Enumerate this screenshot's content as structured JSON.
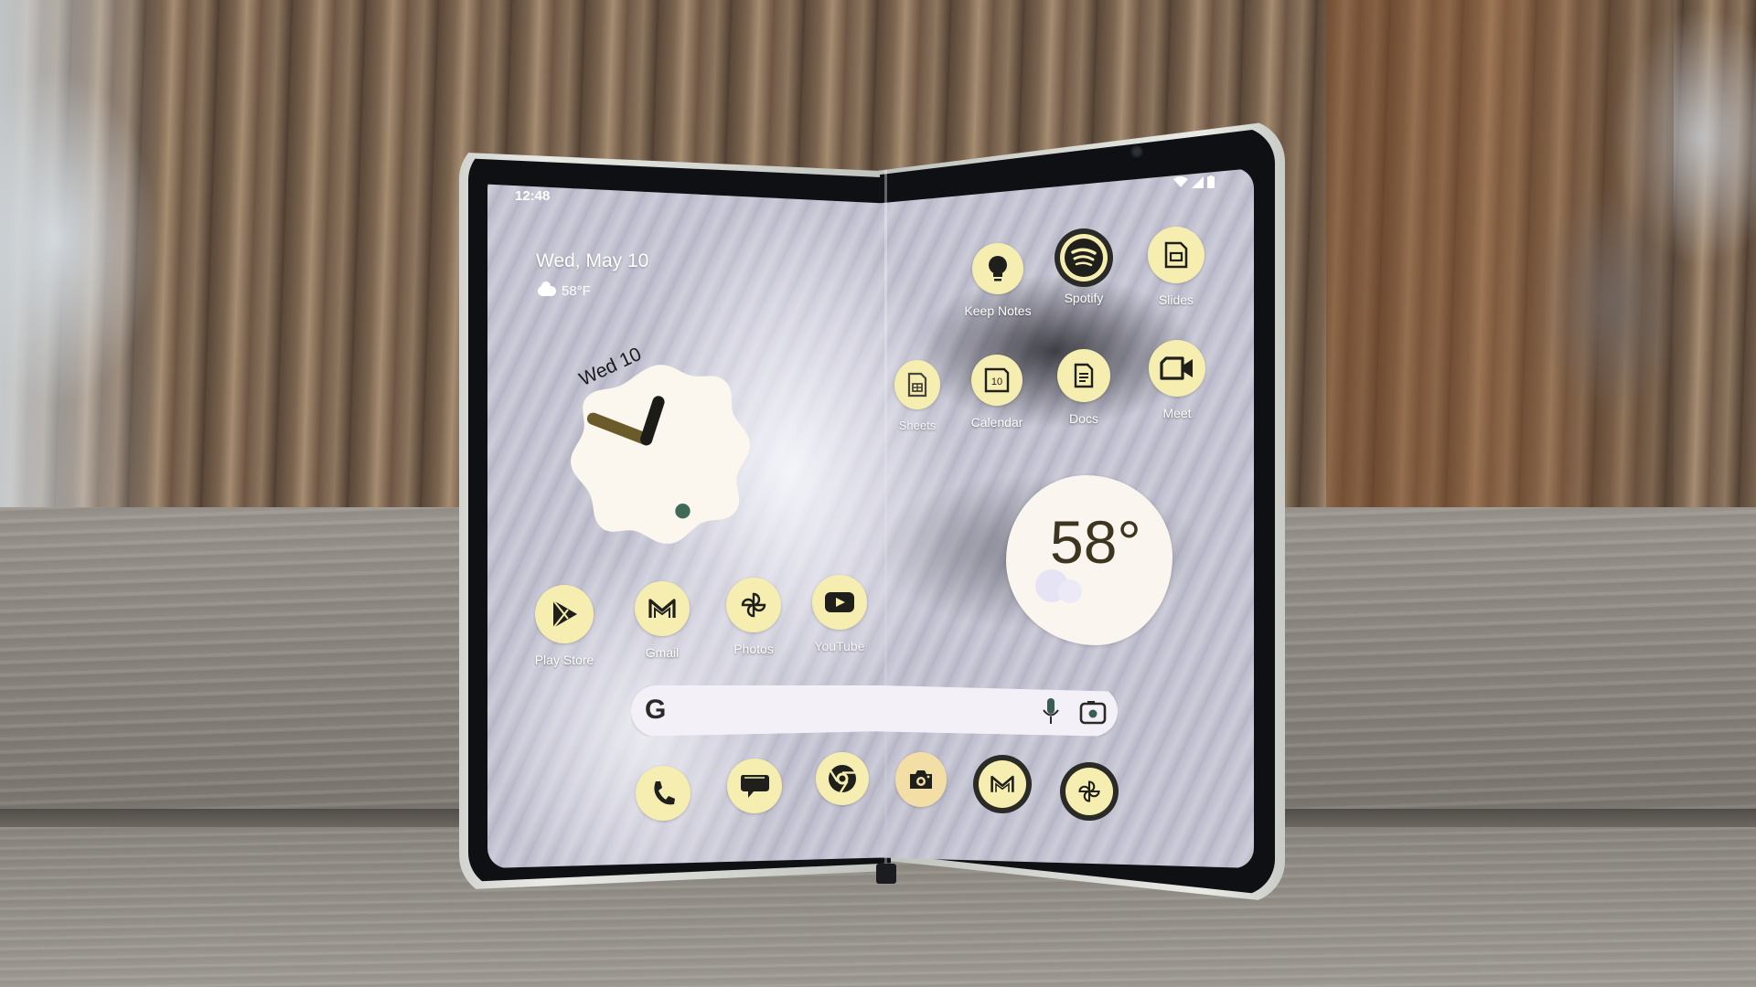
{
  "scene": {
    "description": "Foldable phone standing half-open on a wooden plank in front of a tree trunk",
    "colors": {
      "icon_fill": "#f6eeb0",
      "icon_glyph": "#1f1f1c",
      "screen_wallpaper": "#bcbbcc",
      "widget_fill": "#faf5ef",
      "clock_hour_hand": "#6b5a2a",
      "clock_minute_hand": "#1b1b18",
      "clock_dot": "#3f6b56",
      "temp_text": "#3e3520"
    }
  },
  "status_bar": {
    "time": "12:48",
    "icons": [
      "wifi-icon",
      "cellular-signal-icon",
      "battery-icon"
    ]
  },
  "at_a_glance": {
    "date": "Wed, May 10",
    "weather": "58°F",
    "weather_icon": "cloud-icon"
  },
  "clock_widget": {
    "date": "Wed 10",
    "time": "12:48"
  },
  "weather_widget": {
    "temperature": "58°",
    "condition_icon": "cloud-icon"
  },
  "apps": {
    "right_top_row": [
      {
        "label": "Keep Notes",
        "icon": "lightbulb-icon"
      },
      {
        "label": "Spotify",
        "icon": "spotify-icon"
      },
      {
        "label": "Slides",
        "icon": "slides-icon"
      }
    ],
    "right_second_row": [
      {
        "label": "Sheets",
        "icon": "sheets-icon"
      },
      {
        "label": "Calendar",
        "icon": "calendar-icon",
        "badge": "10"
      },
      {
        "label": "Docs",
        "icon": "docs-icon"
      },
      {
        "label": "Meet",
        "icon": "video-camera-icon"
      }
    ],
    "left_row": [
      {
        "label": "Play Store",
        "icon": "play-store-icon"
      },
      {
        "label": "Gmail",
        "icon": "gmail-icon"
      },
      {
        "label": "Photos",
        "icon": "pinwheel-icon"
      },
      {
        "label": "YouTube",
        "icon": "youtube-icon"
      }
    ]
  },
  "search_bar": {
    "logo": "G",
    "icons": [
      "microphone-icon",
      "google-lens-icon"
    ]
  },
  "dock": [
    {
      "app": "Phone",
      "icon": "phone-icon"
    },
    {
      "app": "Messages",
      "icon": "messages-icon"
    },
    {
      "app": "Chrome",
      "icon": "chrome-icon"
    },
    {
      "app": "Camera",
      "icon": "camera-icon"
    },
    {
      "app": "Gmail",
      "icon": "gmail-icon"
    },
    {
      "app": "Photos",
      "icon": "pinwheel-icon"
    }
  ]
}
